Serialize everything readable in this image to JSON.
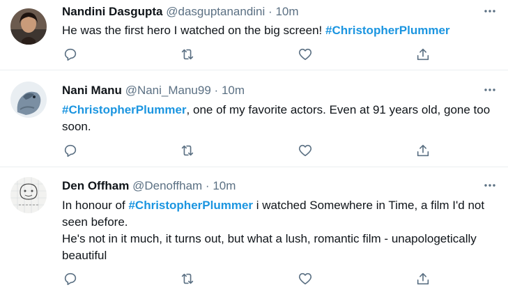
{
  "tweets": [
    {
      "name": "Nandini Dasgupta",
      "handle": "@dasguptanandini",
      "separator": "·",
      "time": "10m",
      "text_before": "He was the first hero I watched on the big screen! ",
      "hashtag": "#ChristopherPlummer",
      "text_after": ""
    },
    {
      "name": "Nani Manu",
      "handle": "@Nani_Manu99",
      "separator": "·",
      "time": "10m",
      "text_before": "",
      "hashtag": "#ChristopherPlummer",
      "text_after": ", one of my favorite actors. Even at 91 years old, gone too soon."
    },
    {
      "name": "Den Offham",
      "handle": "@Denoffham",
      "separator": "·",
      "time": "10m",
      "text_before": "In honour of ",
      "hashtag": "#ChristopherPlummer",
      "text_after": " i watched Somewhere in Time, a film I'd not seen before.",
      "text_line2": "He's not in it much, it turns out, but what a lush, romantic film - unapologetically beautiful"
    }
  ],
  "colors": {
    "hashtag": "#1b95e0",
    "meta": "#5b7083",
    "icon": "#5b7083",
    "divider": "#ebeef0"
  },
  "icons": [
    "reply-icon",
    "retweet-icon",
    "like-icon",
    "share-icon",
    "more-options-icon"
  ]
}
